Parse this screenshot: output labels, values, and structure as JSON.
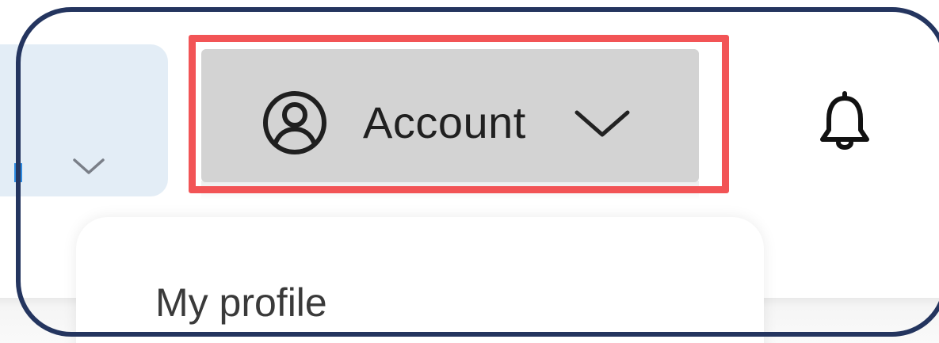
{
  "header": {
    "account": {
      "label": "Account",
      "icon": "user-circle-icon",
      "chevron_icon": "chevron-down-icon"
    },
    "notifications": {
      "icon": "bell-icon"
    },
    "previous_dropdown": {
      "chevron_icon": "chevron-down-icon"
    }
  },
  "account_menu": {
    "items": [
      {
        "label": "My profile"
      }
    ]
  },
  "annotation": {
    "highlight_color": "#f25456",
    "frame_color": "#24355f"
  },
  "colors": {
    "account_button_bg": "#d3d3d3",
    "dropdown_bg": "#e3edf6",
    "accent": "#2d8ae0"
  }
}
